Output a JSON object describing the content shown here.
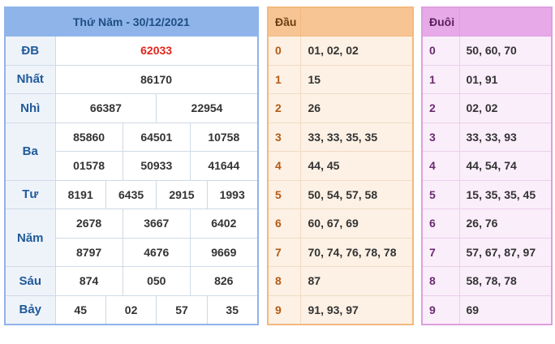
{
  "results": {
    "header": "Thứ Năm - 30/12/2021",
    "rows": {
      "db": {
        "label": "ĐB",
        "values": [
          "62033"
        ]
      },
      "nhat": {
        "label": "Nhất",
        "values": [
          "86170"
        ]
      },
      "nhi": {
        "label": "Nhì",
        "values": [
          "66387",
          "22954"
        ]
      },
      "ba": {
        "label": "Ba",
        "values": [
          "85860",
          "64501",
          "10758",
          "01578",
          "50933",
          "41644"
        ]
      },
      "tu": {
        "label": "Tư",
        "values": [
          "8191",
          "6435",
          "2915",
          "1993"
        ]
      },
      "nam": {
        "label": "Năm",
        "values": [
          "2678",
          "3667",
          "6402",
          "8797",
          "4676",
          "9669"
        ]
      },
      "sau": {
        "label": "Sáu",
        "values": [
          "874",
          "050",
          "826"
        ]
      },
      "bay": {
        "label": "Bảy",
        "values": [
          "45",
          "02",
          "57",
          "35"
        ]
      }
    }
  },
  "dau": {
    "header": "Đầu",
    "rows": [
      {
        "key": "0",
        "value": "01, 02, 02"
      },
      {
        "key": "1",
        "value": "15"
      },
      {
        "key": "2",
        "value": "26"
      },
      {
        "key": "3",
        "value": "33, 33, 35, 35"
      },
      {
        "key": "4",
        "value": "44, 45"
      },
      {
        "key": "5",
        "value": "50, 54, 57, 58"
      },
      {
        "key": "6",
        "value": "60, 67, 69"
      },
      {
        "key": "7",
        "value": "70, 74, 76, 78, 78"
      },
      {
        "key": "8",
        "value": "87"
      },
      {
        "key": "9",
        "value": "91, 93, 97"
      }
    ]
  },
  "duoi": {
    "header": "Đuôi",
    "rows": [
      {
        "key": "0",
        "value": "50, 60, 70"
      },
      {
        "key": "1",
        "value": "01, 91"
      },
      {
        "key": "2",
        "value": "02, 02"
      },
      {
        "key": "3",
        "value": "33, 33, 93"
      },
      {
        "key": "4",
        "value": "44, 54, 74"
      },
      {
        "key": "5",
        "value": "15, 35, 35, 45"
      },
      {
        "key": "6",
        "value": "26, 76"
      },
      {
        "key": "7",
        "value": "57, 67, 87, 97"
      },
      {
        "key": "8",
        "value": "58, 78, 78"
      },
      {
        "key": "9",
        "value": "69"
      }
    ]
  },
  "colors": {
    "results_header": "#8fb4ea",
    "dau_header": "#f7c594",
    "duoi_header": "#e8a9e8",
    "special_prize": "#e0261c"
  }
}
